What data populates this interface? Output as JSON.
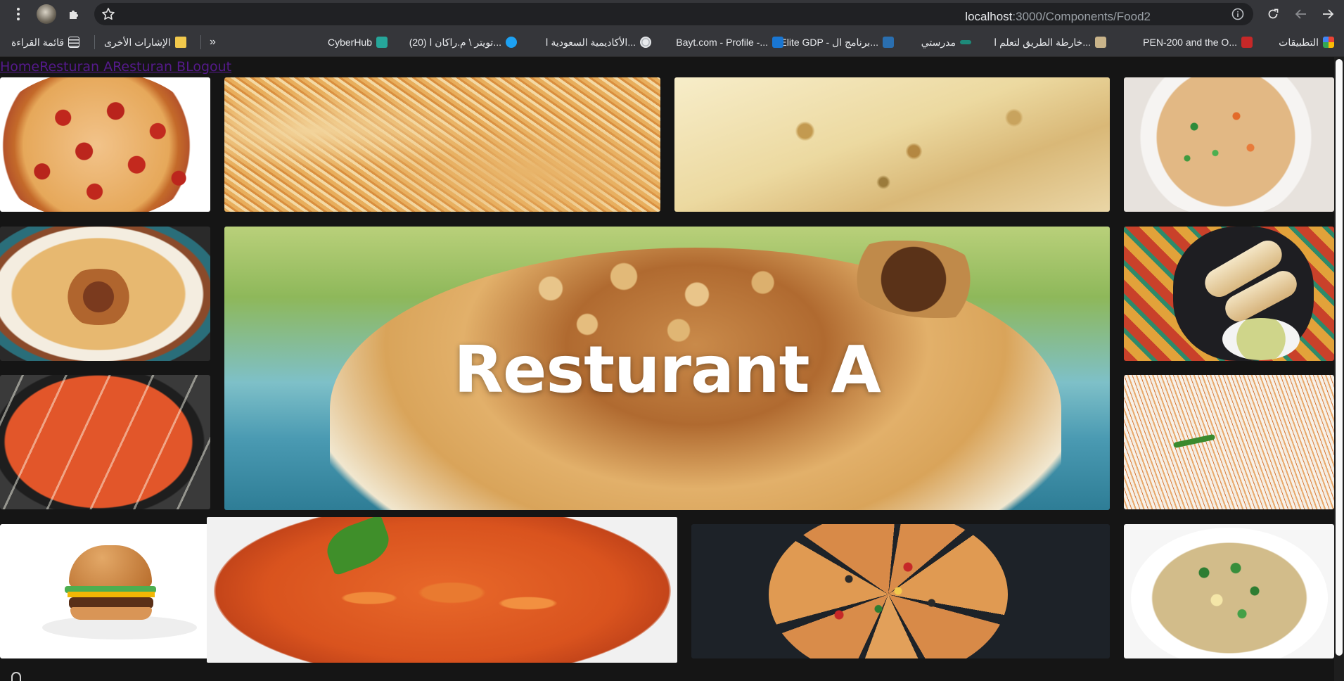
{
  "browser": {
    "url_host": "localhost",
    "url_path": ":3000/Components/Food2",
    "icons": [
      "menu-dots-icon",
      "profile-avatar-icon",
      "extensions-icon",
      "bookmark-star-icon",
      "site-info-icon",
      "reload-icon",
      "back-icon",
      "forward-icon"
    ]
  },
  "bookmarks": {
    "overflow_label": "»",
    "items": [
      {
        "label": "التطبيقات",
        "icon": "apps-grid-icon"
      },
      {
        "label": "PEN-200 and the O...",
        "icon": "pen200-icon"
      },
      {
        "label": "خارطة الطريق لتعلم ا...",
        "icon": "roadmap-icon"
      },
      {
        "label": "مدرستي",
        "icon": "madrasati-icon"
      },
      {
        "label": "Elite GDP - برنامج ال...",
        "icon": "elite-gdp-icon"
      },
      {
        "label": "Bayt.com - Profile -...",
        "icon": "bayt-icon"
      },
      {
        "label": "الأكاديمية السعودية ا...",
        "icon": "globe-icon"
      },
      {
        "label": "(20) تويتر \\ م.راكان ا...",
        "icon": "twitter-icon"
      },
      {
        "label": "CyberHub",
        "icon": "cyberhub-icon"
      }
    ],
    "other_bookmarks": "الإشارات الأخرى",
    "reading_list": "قائمة القراءة"
  },
  "nav": {
    "links": [
      "Home",
      "Resturan A",
      "Resturan B",
      "Logout"
    ]
  },
  "hero": {
    "title": "Resturant A"
  },
  "gallery": {
    "tiles": [
      "pepperoni-pizza",
      "oyster-biryani",
      "stuffed-flatbread",
      "vegetable-fried-rice",
      "chicken-biryani-plate",
      "lamb-biryani-hero",
      "dosa-chutney",
      "butter-chicken-bowl",
      "saffron-rice",
      "cheeseburger",
      "butter-chicken-closeup",
      "sliced-pizza-dark",
      "egg-fried-rice"
    ]
  },
  "colors": {
    "browser_frame": "#35363a",
    "omnibox": "#202124",
    "page_bg": "#151515",
    "visited_link": "#551a8b",
    "hero_title": "#ffffff"
  }
}
